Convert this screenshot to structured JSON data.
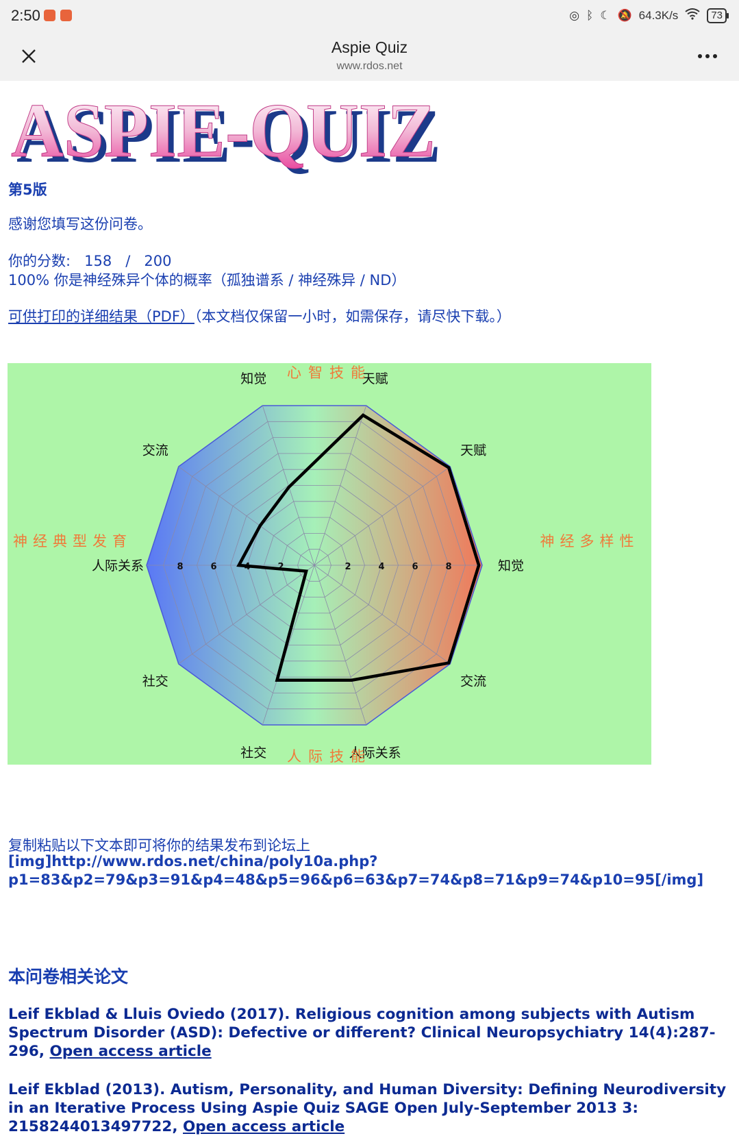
{
  "status_bar": {
    "time": "2:50",
    "network_speed": "64.3K/s",
    "battery": "73",
    "icons": [
      "nfc-icon",
      "bluetooth-icon",
      "moon-icon",
      "mute-icon",
      "wifi-icon",
      "battery-icon"
    ]
  },
  "header": {
    "title": "Aspie Quiz",
    "url": "www.rdos.net"
  },
  "logo": {
    "text": "ASPIE-QUIZ"
  },
  "page": {
    "edition": "第5版",
    "thanks": "感谢您填写这份问卷。",
    "score_label": "你的分数:",
    "score_value": "158",
    "score_separator": "/",
    "score_max": "200",
    "probability": "100% 你是神经殊异个体的概率（孤独谱系 / 神经殊异 / ND）",
    "pdf_link": "可供打印的详细结果（PDF）",
    "pdf_note": "（本文档仅保留一小时，如需保存，请尽快下载。）",
    "copy_instruction": "复制粘贴以下文本即可将你的结果发布到论坛上",
    "code_line1": "[img]http://www.rdos.net/china/poly10a.php?",
    "code_line2": "p1=83&p2=79&p3=91&p4=48&p5=96&p6=63&p7=74&p8=71&p9=74&p10=95[/img]",
    "papers_title": "本问卷相关论文",
    "ref1_text": "Leif Ekblad & Lluis Oviedo (2017). Religious cognition among subjects with Autism Spectrum Disorder (ASD): Defective or different? Clinical Neuropsychiatry 14(4):287-296, ",
    "ref1_link": "Open access article",
    "ref2_text": "Leif Ekblad (2013). Autism, Personality, and Human Diversity: Defining Neurodiversity in an Iterative Process Using Aspie Quiz SAGE Open July-September 2013 3: 2158244013497722, ",
    "ref2_link": "Open access article"
  },
  "chart_data": {
    "type": "radar",
    "title_top": "心智技能",
    "title_bottom": "人际技能",
    "left_label": "神经典型发育",
    "right_label": "神经多样性",
    "axes": [
      "天赋",
      "天赋",
      "知觉",
      "交流",
      "人际关系",
      "社交",
      "社交",
      "人际关系",
      "交流",
      "知觉"
    ],
    "values": [
      0.94,
      0.99,
      0.98,
      0.99,
      0.72,
      0.72,
      0.06,
      0.45,
      0.4,
      0.49
    ],
    "tick_labels": [
      "2",
      "4",
      "6",
      "8"
    ],
    "rings": 10,
    "colors": {
      "neurotypical": "#5a78f5",
      "neurodiverse": "#f0785a",
      "background": "#aef5a8",
      "line": "#000000",
      "label": "#f07a3a"
    }
  }
}
